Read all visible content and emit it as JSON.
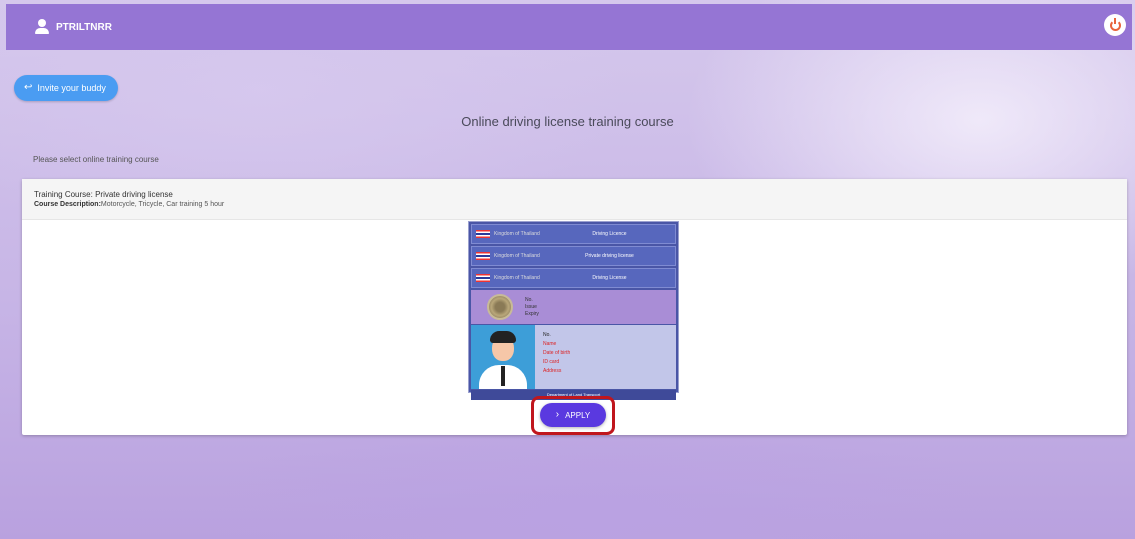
{
  "header": {
    "username": "PTRILTNRR",
    "user_icon": "user-icon",
    "logout_icon": "power-icon",
    "accent_color": "#9575d4"
  },
  "back_button": {
    "label": "Invite your buddy",
    "icon": "back-arrow-icon",
    "color": "#4a9cf2"
  },
  "page_title": "Online driving license training course",
  "select_label": "Please select online training course",
  "course": {
    "name": "Training Course: Private driving license",
    "description_label": "Course Description:",
    "description": "Motorcycle, Tricycle, Car training 5 hour",
    "license_image": {
      "rows": [
        {
          "left": "Kingdom of Thailand",
          "right": "Driving Licence"
        },
        {
          "left": "Kingdom of Thailand",
          "right": "Private driving license"
        },
        {
          "left": "Kingdom of Thailand",
          "right": "Driving License"
        }
      ],
      "mid_lines": [
        "No.",
        "Issue",
        "Expiry"
      ],
      "data_lines": [
        "No.",
        "Name",
        "Date of birth",
        "ID card",
        "Address"
      ],
      "footer": "Department of Land Transport"
    }
  },
  "apply_button": {
    "label": "APPLY",
    "icon": "chevron-right-icon",
    "color": "#5a39e0",
    "highlight_color": "#c0161d"
  }
}
